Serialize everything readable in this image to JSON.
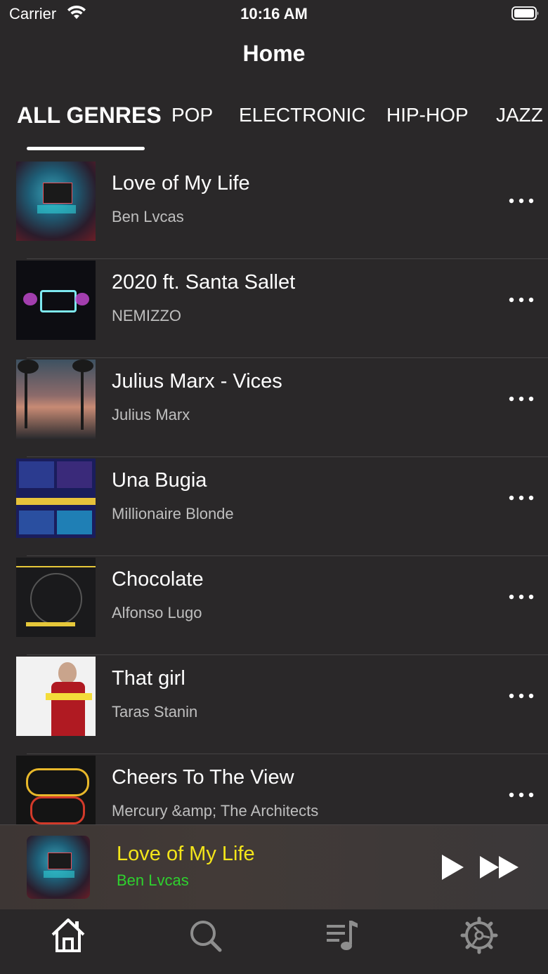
{
  "status_bar": {
    "carrier": "Carrier",
    "time": "10:16 AM"
  },
  "header": {
    "title": "Home"
  },
  "genre_tabs": [
    {
      "label": "ALL GENRES",
      "active": true
    },
    {
      "label": "POP",
      "active": false
    },
    {
      "label": "ELECTRONIC",
      "active": false
    },
    {
      "label": "HIP-HOP",
      "active": false
    },
    {
      "label": "JAZZ",
      "active": false
    }
  ],
  "tracks": [
    {
      "title": "Love of My Life",
      "artist": "Ben Lvcas"
    },
    {
      "title": "2020 ft. Santa Sallet",
      "artist": "NEMIZZO"
    },
    {
      "title": "Julius Marx - Vices",
      "artist": "Julius Marx"
    },
    {
      "title": "Una Bugia",
      "artist": "Millionaire Blonde"
    },
    {
      "title": "Chocolate",
      "artist": "Alfonso Lugo"
    },
    {
      "title": "That girl",
      "artist": "Taras Stanin"
    },
    {
      "title": "Cheers To The View",
      "artist": "Mercury &amp; The Architects"
    }
  ],
  "now_playing": {
    "title": "Love of My Life",
    "artist": "Ben Lvcas"
  },
  "tab_bar": {
    "items": [
      "home-icon",
      "search-icon",
      "playlist-icon",
      "settings-icon"
    ]
  },
  "colors": {
    "background": "#2a2829",
    "now_playing_title": "#f3e51a",
    "now_playing_artist": "#2ed12e",
    "secondary_text": "#bfbfbf"
  }
}
